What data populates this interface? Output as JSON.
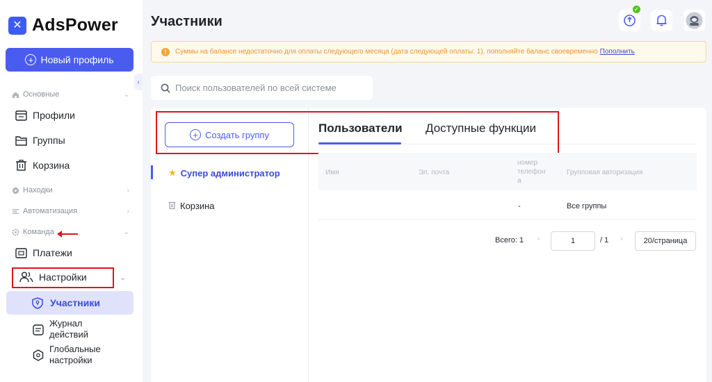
{
  "app": {
    "name": "AdsPower",
    "logo_glyph": "✕"
  },
  "sidebar": {
    "new_profile_label": "Новый профиль",
    "collapse_glyph": "‹",
    "sections": {
      "basic": "Основные",
      "finds": "Находки",
      "automation": "Автоматизация",
      "team": "Команда"
    },
    "items": {
      "profiles": "Профили",
      "groups": "Группы",
      "trash": "Корзина",
      "payments": "Платежи",
      "settings": "Настройки"
    },
    "sub_items": {
      "members": "Участники",
      "journal_line1": "Журнал",
      "journal_line2": "действий",
      "global_line1": "Глобальные",
      "global_line2": "настройки"
    }
  },
  "header": {
    "title": "Участники",
    "icons": [
      "sync-icon",
      "bell-icon",
      "avatar"
    ],
    "sync_badge": "✓"
  },
  "notice": {
    "icon": "!",
    "text": "Суммы на балансе недостаточно для оплаты следующего месяца (дата следующей оплаты: 1), пополняйте баланс своевременно",
    "link": "Пополнить"
  },
  "search": {
    "placeholder": "Поиск пользователей по всей системе"
  },
  "groups_panel": {
    "create_label": "Создать группу",
    "items": [
      {
        "label": "Супер администратор",
        "active": true
      },
      {
        "label": "Корзина",
        "active": false
      }
    ]
  },
  "tabs": [
    {
      "label": "Пользователи",
      "active": true
    },
    {
      "label": "Доступные функции",
      "active": false
    }
  ],
  "table": {
    "columns": {
      "name": "Имя",
      "email": "Эл. почта",
      "phone_l1": "номер",
      "phone_l2": "телефон",
      "phone_l3": "а",
      "group_auth": "Групповая авторизация"
    },
    "rows": [
      {
        "name": "",
        "email": "",
        "phone": "-",
        "group_auth": "Все группы"
      }
    ]
  },
  "pagination": {
    "total": "Всего: 1",
    "prev": "‹",
    "next": "›",
    "page": "1",
    "of": "/ 1",
    "page_size": "20/страница"
  },
  "colors": {
    "accent": "#4a5cf0",
    "annotation_red": "#e01515",
    "warning": "#e8962e"
  }
}
